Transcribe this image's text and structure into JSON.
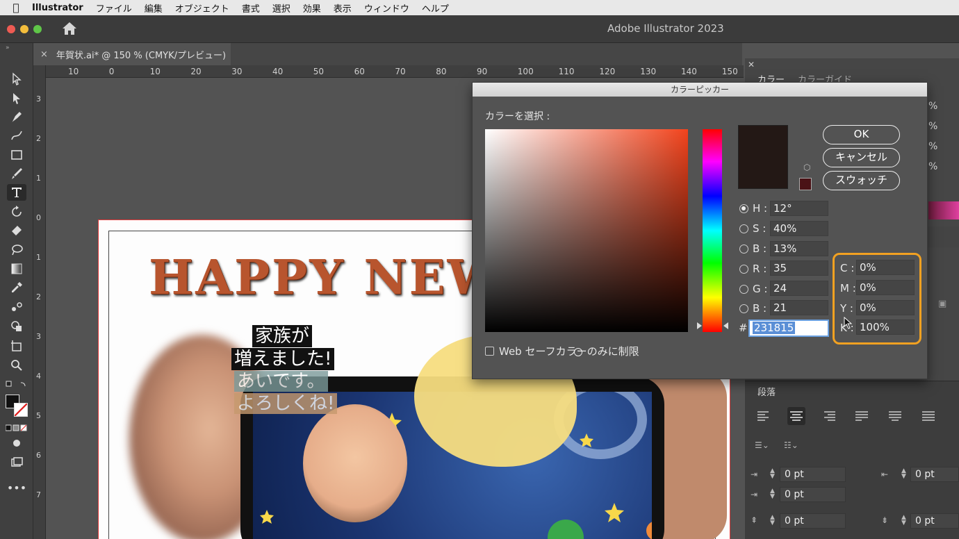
{
  "menubar": {
    "app_name": "Illustrator",
    "items": [
      "ファイル",
      "編集",
      "オブジェクト",
      "書式",
      "選択",
      "効果",
      "表示",
      "ウィンドウ",
      "ヘルプ"
    ]
  },
  "window": {
    "title": "Adobe Illustrator 2023"
  },
  "document_tab": {
    "label": "年賀状.ai* @ 150 % (CMYK/プレビュー)",
    "close": "×"
  },
  "ruler": {
    "h_ticks": [
      "10",
      "0",
      "10",
      "20",
      "30",
      "40",
      "50",
      "60",
      "70",
      "80",
      "90",
      "100",
      "110",
      "120",
      "130",
      "140",
      "150"
    ],
    "v_ticks": [
      "3",
      "2",
      "1",
      "0",
      "1",
      "2",
      "3",
      "4",
      "5",
      "6",
      "7"
    ]
  },
  "artboard": {
    "headline": "HAPPY NEW",
    "captions": [
      "家族が",
      "増えました!",
      "あいです。",
      "よろしくね!"
    ]
  },
  "color_picker": {
    "title": "カラーピッカー",
    "prompt": "カラーを選択 :",
    "buttons": {
      "ok": "OK",
      "cancel": "キャンセル",
      "swatches": "スウォッチ"
    },
    "hsb": [
      {
        "label": "H :",
        "value": "12°",
        "selected": true
      },
      {
        "label": "S :",
        "value": "40%"
      },
      {
        "label": "B :",
        "value": "13%"
      }
    ],
    "rgb": [
      {
        "label": "R :",
        "value": "35"
      },
      {
        "label": "G :",
        "value": "24"
      },
      {
        "label": "B :",
        "value": "21"
      }
    ],
    "hex_label": "#",
    "hex_value": "231815",
    "cmyk": [
      {
        "label": "C :",
        "value": "0%"
      },
      {
        "label": "M :",
        "value": "0%"
      },
      {
        "label": "Y :",
        "value": "0%"
      },
      {
        "label": "K :",
        "value": "100%"
      }
    ],
    "websafe_label": "Web セーフカラーのみに制限",
    "current_color": "#231815",
    "highlight_color": "#f2a121"
  },
  "color_panel": {
    "tabs": [
      "カラー",
      "カラーガイド"
    ],
    "percent_signs": [
      "%",
      "%",
      "%",
      "%"
    ]
  },
  "paragraph_panel": {
    "title": "段落",
    "indent_left": "0 pt",
    "indent_right": "0 pt",
    "first_line": "0 pt",
    "space_before": "0 pt",
    "space_after": "0 pt"
  }
}
